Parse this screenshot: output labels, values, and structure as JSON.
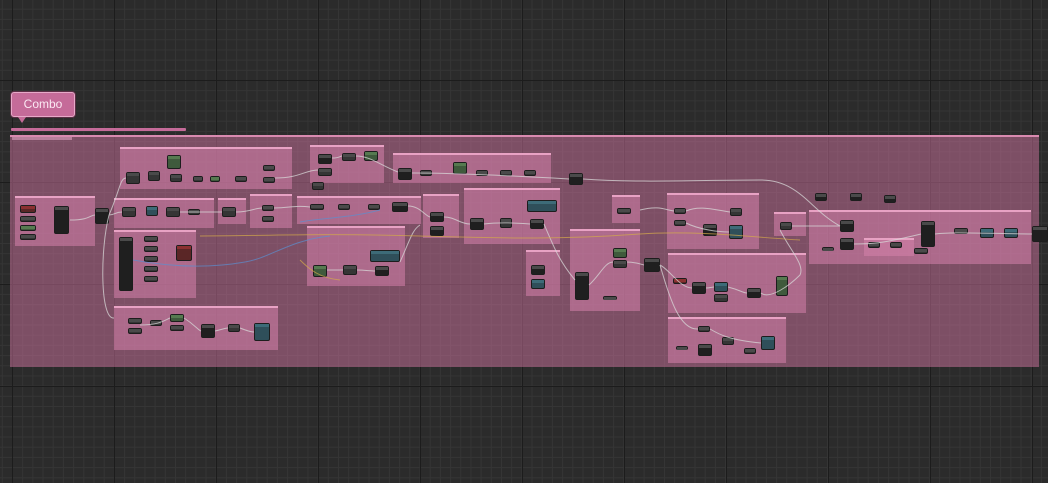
{
  "canvas": {
    "group_label": "Combo"
  },
  "colors": {
    "background": "#2b2b2b",
    "group_fill": "#c16d96",
    "group_border": "#d98ab0",
    "node": "#353535",
    "wire": "#d8d8d8"
  }
}
